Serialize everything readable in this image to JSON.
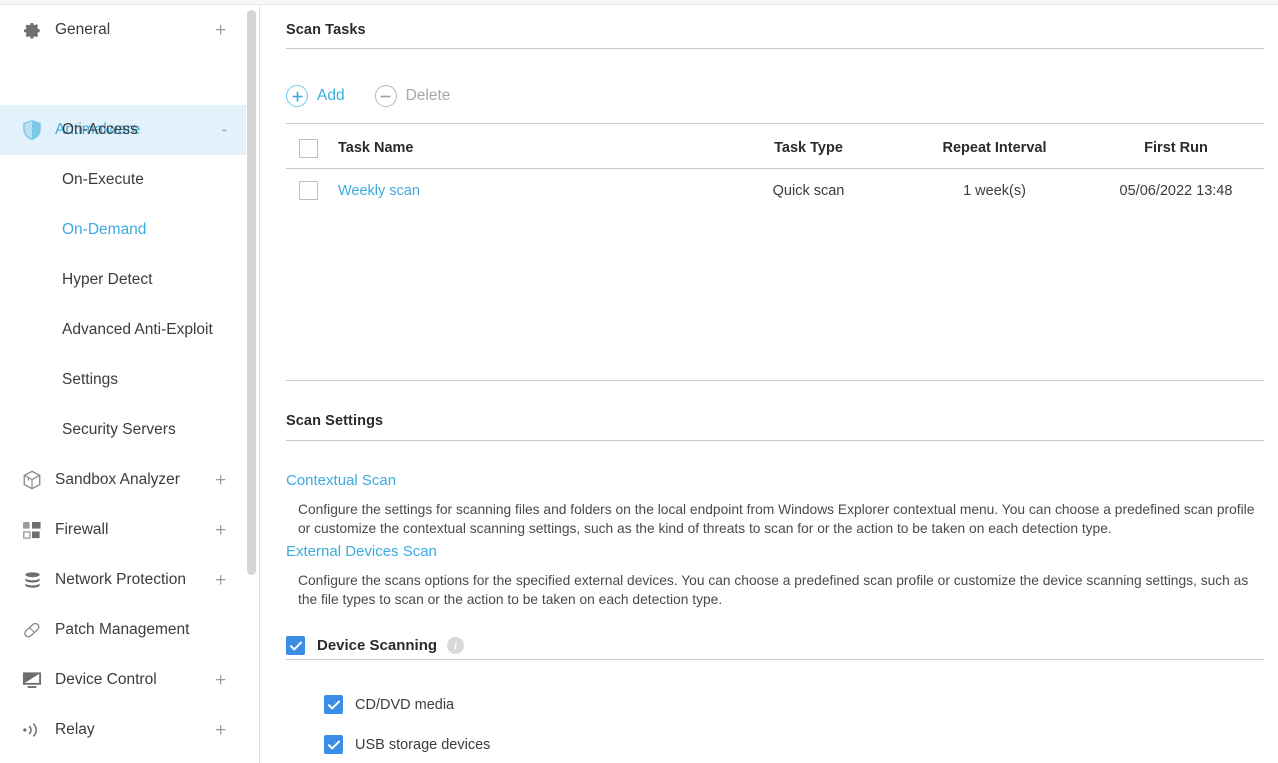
{
  "sidebar": {
    "items": [
      {
        "label": "General",
        "icon": "gear-icon",
        "expander": "+",
        "level": "top",
        "active": false
      },
      {
        "label": "Antimalware",
        "icon": "shield-icon",
        "expander": "-",
        "level": "top",
        "active": true
      },
      {
        "label": "On-Access",
        "icon": "",
        "expander": "",
        "level": "sub",
        "active": false
      },
      {
        "label": "On-Execute",
        "icon": "",
        "expander": "",
        "level": "sub",
        "active": false
      },
      {
        "label": "On-Demand",
        "icon": "",
        "expander": "",
        "level": "sub",
        "active": true
      },
      {
        "label": "Hyper Detect",
        "icon": "",
        "expander": "",
        "level": "sub",
        "active": false
      },
      {
        "label": "Advanced Anti-Exploit",
        "icon": "",
        "expander": "",
        "level": "sub",
        "active": false
      },
      {
        "label": "Settings",
        "icon": "",
        "expander": "",
        "level": "sub",
        "active": false
      },
      {
        "label": "Security Servers",
        "icon": "",
        "expander": "",
        "level": "sub",
        "active": false
      },
      {
        "label": "Sandbox Analyzer",
        "icon": "cube-icon",
        "expander": "+",
        "level": "top",
        "active": false
      },
      {
        "label": "Firewall",
        "icon": "firewall-icon",
        "expander": "+",
        "level": "top",
        "active": false
      },
      {
        "label": "Network Protection",
        "icon": "network-stack-icon",
        "expander": "+",
        "level": "top",
        "active": false
      },
      {
        "label": "Patch Management",
        "icon": "bandage-icon",
        "expander": "",
        "level": "top",
        "active": false
      },
      {
        "label": "Device Control",
        "icon": "monitor-icon",
        "expander": "+",
        "level": "top",
        "active": false
      },
      {
        "label": "Relay",
        "icon": "broadcast-icon",
        "expander": "+",
        "level": "top",
        "active": false
      }
    ]
  },
  "main": {
    "scan_tasks": {
      "title": "Scan Tasks",
      "toolbar": {
        "add_label": "Add",
        "delete_label": "Delete"
      },
      "columns": [
        "Task Name",
        "Task Type",
        "Repeat Interval",
        "First Run"
      ],
      "rows": [
        {
          "name": "Weekly scan",
          "type": "Quick scan",
          "repeat": "1 week(s)",
          "first_run": "05/06/2022 13:48",
          "selected": false
        }
      ]
    },
    "scan_settings": {
      "title": "Scan Settings",
      "links": [
        {
          "label": "Contextual Scan",
          "description": "Configure the settings for scanning files and folders on the local endpoint from Windows Explorer contextual menu. You can choose a predefined scan profile or customize the contextual scanning settings, such as the kind of threats to scan for or the action to be taken on each detection type."
        },
        {
          "label": "External Devices Scan",
          "description": "Configure the scans options for the specified external devices. You can choose a predefined scan profile or customize the device scanning settings, such as the file types to scan or the action to be taken on each detection type."
        }
      ],
      "device_scanning": {
        "label": "Device Scanning",
        "checked": true,
        "info_glyph": "i",
        "options": [
          {
            "label": "CD/DVD media",
            "checked": true
          },
          {
            "label": "USB storage devices",
            "checked": true
          }
        ]
      }
    }
  },
  "colors": {
    "accent_blue": "#3cabe0",
    "checkbox_blue": "#3a8ee6",
    "active_nav_bg": "#e3f2fa",
    "text_dark": "#2b2b2b",
    "muted": "#a8a8a8",
    "rule": "#c8c8c8"
  }
}
